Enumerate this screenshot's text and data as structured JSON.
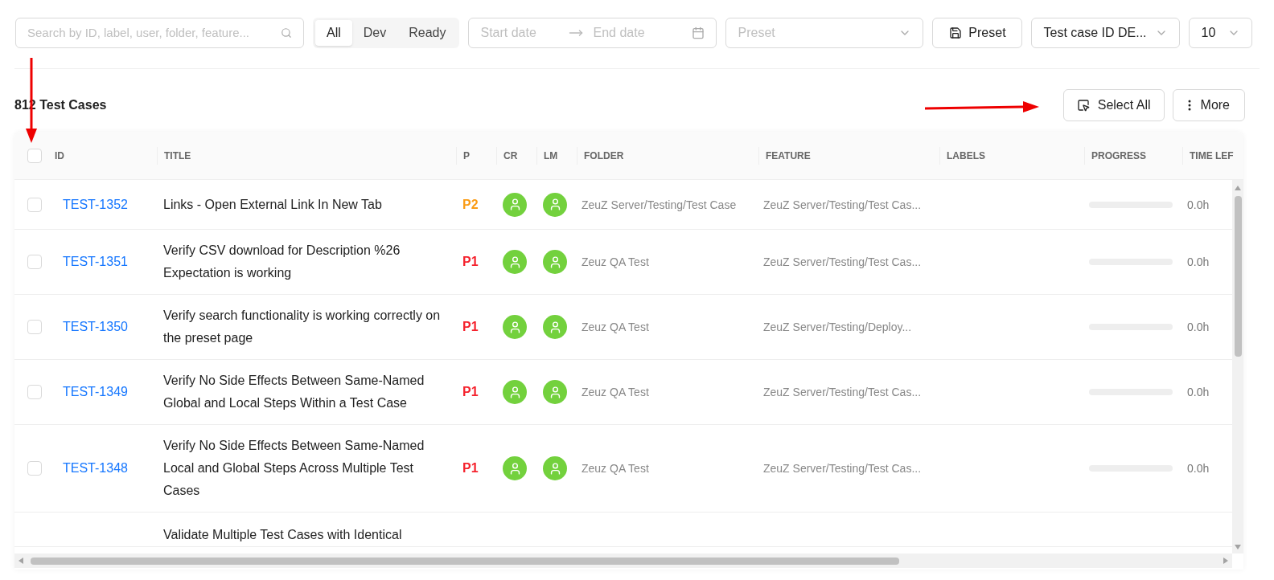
{
  "toolbar": {
    "search": {
      "placeholder": "Search by ID, label, user, folder, feature..."
    },
    "status_tabs": [
      {
        "label": "All",
        "selected": true
      },
      {
        "label": "Dev",
        "selected": false
      },
      {
        "label": "Ready",
        "selected": false
      }
    ],
    "date_range": {
      "start_placeholder": "Start date",
      "end_placeholder": "End date"
    },
    "preset_select": {
      "placeholder": "Preset"
    },
    "preset_button": "Preset",
    "sort_select": {
      "value": "Test case ID DE..."
    },
    "page_size_select": {
      "value": "10"
    }
  },
  "summary": {
    "count": "812 Test Cases",
    "select_all_button": "Select All",
    "more_button": "More"
  },
  "table": {
    "select_all_checked": false,
    "columns": [
      "ID",
      "TITLE",
      "P",
      "CR",
      "LM",
      "FOLDER",
      "FEATURE",
      "LABELS",
      "PROGRESS",
      "TIME LEF"
    ],
    "rows": [
      {
        "checked": false,
        "id": "TEST-1352",
        "title": "Links - Open External Link In New Tab",
        "priority": {
          "text": "P2",
          "color": "#fa9c16"
        },
        "folder": "ZeuZ Server/Testing/Test Case",
        "feature": "ZeuZ Server/Testing/Test Cas...",
        "progress": {
          "level": 0
        },
        "time_left": "0.0h"
      },
      {
        "checked": false,
        "id": "TEST-1351",
        "title": "Verify CSV download for Description %26 Expectation is working",
        "priority": {
          "text": "P1",
          "color": "#f5222d"
        },
        "folder": "Zeuz QA Test",
        "feature": "ZeuZ Server/Testing/Test Cas...",
        "progress": {
          "level": 0
        },
        "time_left": "0.0h"
      },
      {
        "checked": false,
        "id": "TEST-1350",
        "title": "Verify search functionality is working correctly on the preset page",
        "priority": {
          "text": "P1",
          "color": "#f5222d"
        },
        "folder": "Zeuz QA Test",
        "feature": "ZeuZ Server/Testing/Deploy...",
        "progress": {
          "level": 0
        },
        "time_left": "0.0h"
      },
      {
        "checked": false,
        "id": "TEST-1349",
        "title": "Verify No Side Effects Between Same-Named Global and Local Steps Within a Test Case",
        "priority": {
          "text": "P1",
          "color": "#f5222d"
        },
        "folder": "Zeuz QA Test",
        "feature": "ZeuZ Server/Testing/Test Cas...",
        "progress": {
          "level": 0
        },
        "time_left": "0.0h"
      },
      {
        "checked": false,
        "id": "TEST-1348",
        "title": "Verify No Side Effects Between Same-Named Local and Global Steps Across Multiple Test Cases",
        "priority": {
          "text": "P1",
          "color": "#f5222d"
        },
        "folder": "Zeuz QA Test",
        "feature": "ZeuZ Server/Testing/Test Cas...",
        "progress": {
          "level": 0
        },
        "time_left": "0.0h"
      },
      {
        "title": "Validate Multiple Test Cases with Identical"
      }
    ]
  }
}
